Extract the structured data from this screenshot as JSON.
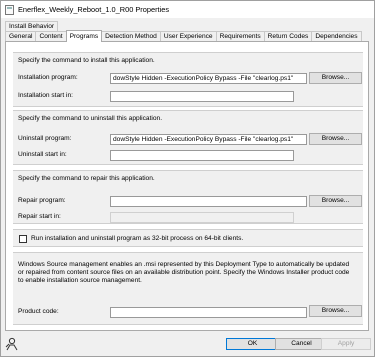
{
  "window": {
    "title": "Enerflex_Weekly_Reboot_1.0_R00 Properties"
  },
  "tabs_top": [
    "Install Behavior"
  ],
  "tabs": [
    "General",
    "Content",
    "Programs",
    "Detection Method",
    "User Experience",
    "Requirements",
    "Return Codes",
    "Dependencies"
  ],
  "install": {
    "description": "Specify the command to install this application.",
    "program_label": "Installation program:",
    "program_value": "dowStyle Hidden -ExecutionPolicy Bypass -File \"clearlog.ps1\"",
    "browse_label": "Browse...",
    "start_in_label": "Installation start in:",
    "start_in_value": ""
  },
  "uninstall": {
    "description": "Specify the command to uninstall this application.",
    "program_label": "Uninstall program:",
    "program_value": "dowStyle Hidden -ExecutionPolicy Bypass -File \"clearlog.ps1\"",
    "browse_label": "Browse...",
    "start_in_label": "Uninstall start in:",
    "start_in_value": ""
  },
  "repair": {
    "description": "Specify the command to repair this application.",
    "program_label": "Repair program:",
    "program_value": "",
    "browse_label": "Browse...",
    "start_in_label": "Repair start in:",
    "start_in_value": ""
  },
  "checkbox32": {
    "label": "Run installation and uninstall program as 32-bit process on 64-bit clients."
  },
  "source_mgmt": {
    "text": "Windows Source management enables an .msi represented by this Deployment Type to automatically be updated or repaired from content source files on an available distribution point. Specify the Windows Installer product code to enable installation source management.",
    "product_code_label": "Product code:",
    "product_code_value": "",
    "browse_label": "Browse..."
  },
  "footer": {
    "ok": "OK",
    "cancel": "Cancel",
    "apply": "Apply"
  }
}
